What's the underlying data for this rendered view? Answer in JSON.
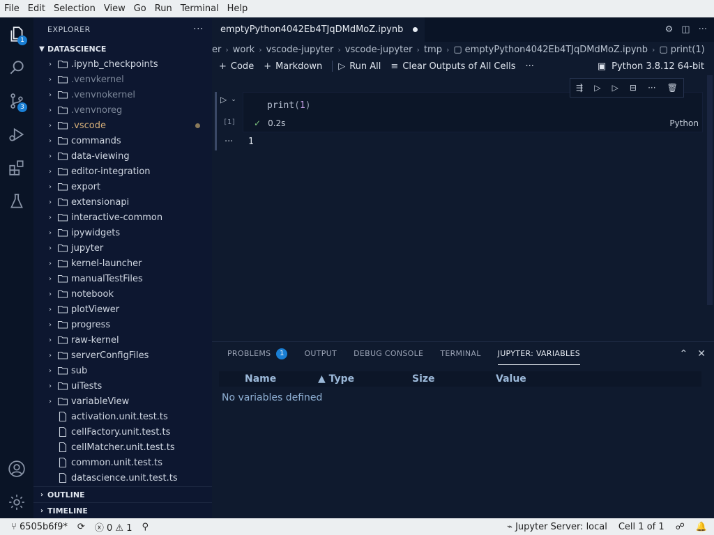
{
  "menu": [
    "File",
    "Edit",
    "Selection",
    "View",
    "Go",
    "Run",
    "Terminal",
    "Help"
  ],
  "activity": {
    "explorer_badge": "1",
    "scm_badge": "3"
  },
  "sidebar": {
    "title": "EXPLORER",
    "root": "DATASCIENCE",
    "folders": [
      ".ipynb_checkpoints",
      ".venvkernel",
      ".venvnokernel",
      ".venvnoreg",
      ".vscode",
      "commands",
      "data-viewing",
      "editor-integration",
      "export",
      "extensionapi",
      "interactive-common",
      "ipywidgets",
      "jupyter",
      "kernel-launcher",
      "manualTestFiles",
      "notebook",
      "plotViewer",
      "progress",
      "raw-kernel",
      "serverConfigFiles",
      "sub",
      "uiTests",
      "variableView"
    ],
    "files": [
      "activation.unit.test.ts",
      "cellFactory.unit.test.ts",
      "cellMatcher.unit.test.ts",
      "common.unit.test.ts",
      "datascience.unit.test.ts"
    ],
    "outline": "OUTLINE",
    "timeline": "TIMELINE"
  },
  "editor": {
    "tab_title": "emptyPython4042Eb4TJqDMdMoZ.ipynb",
    "breadcrumbs": [
      "er",
      "work",
      "vscode-jupyter",
      "vscode-jupyter",
      "tmp",
      "emptyPython4042Eb4TJqDMdMoZ.ipynb",
      "print(1)"
    ],
    "toolbar": {
      "code": "Code",
      "markdown": "Markdown",
      "run_all": "Run All",
      "clear": "Clear Outputs of All Cells",
      "more": "···"
    },
    "kernel": "Python 3.8.12 64-bit",
    "cell": {
      "fn": "print",
      "open": "(",
      "arg": "1",
      "close": ")",
      "exec_count": "[1]",
      "duration": "0.2s",
      "language": "Python",
      "output_marker": "···",
      "output": "1"
    }
  },
  "panel": {
    "tabs": {
      "problems": "PROBLEMS",
      "problems_count": "1",
      "output": "OUTPUT",
      "debug": "DEBUG CONSOLE",
      "terminal": "TERMINAL",
      "variables": "JUPYTER: VARIABLES"
    },
    "columns": {
      "name": "Name",
      "type": "▲ Type",
      "size": "Size",
      "value": "Value"
    },
    "empty": "No variables defined"
  },
  "status": {
    "branch": "6505b6f9*",
    "errors": "0",
    "warnings": "1",
    "server": "Jupyter Server: local",
    "cell": "Cell 1 of 1"
  }
}
